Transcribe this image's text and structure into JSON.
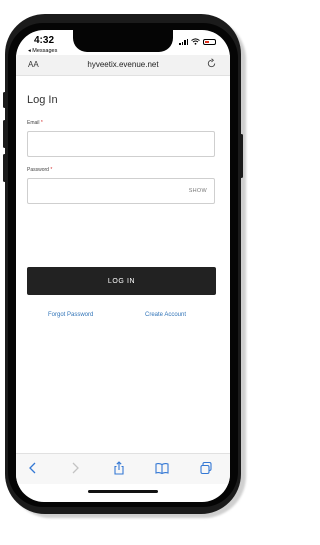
{
  "status_bar": {
    "time": "4:32",
    "back_label": "◂ Messages",
    "battery_color": "#e0311d"
  },
  "address_bar": {
    "text_size_label": "AA",
    "url": "hyveetix.evenue.net",
    "reload_icon": "reload-icon"
  },
  "login_form": {
    "title": "Log In",
    "email": {
      "label": "Email",
      "required_mark": "*",
      "value": ""
    },
    "password": {
      "label": "Password",
      "required_mark": "*",
      "value": "",
      "show_label": "SHOW"
    },
    "submit_label": "LOG IN",
    "forgot_password_label": "Forgot Password",
    "create_account_label": "Create Account"
  },
  "toolbar": {
    "items": [
      "back-arrow-icon",
      "forward-arrow-icon",
      "share-icon",
      "bookmarks-icon",
      "tabs-icon"
    ]
  },
  "colors": {
    "link": "#3174b8",
    "button": "#222222",
    "required": "#d32f2f"
  }
}
